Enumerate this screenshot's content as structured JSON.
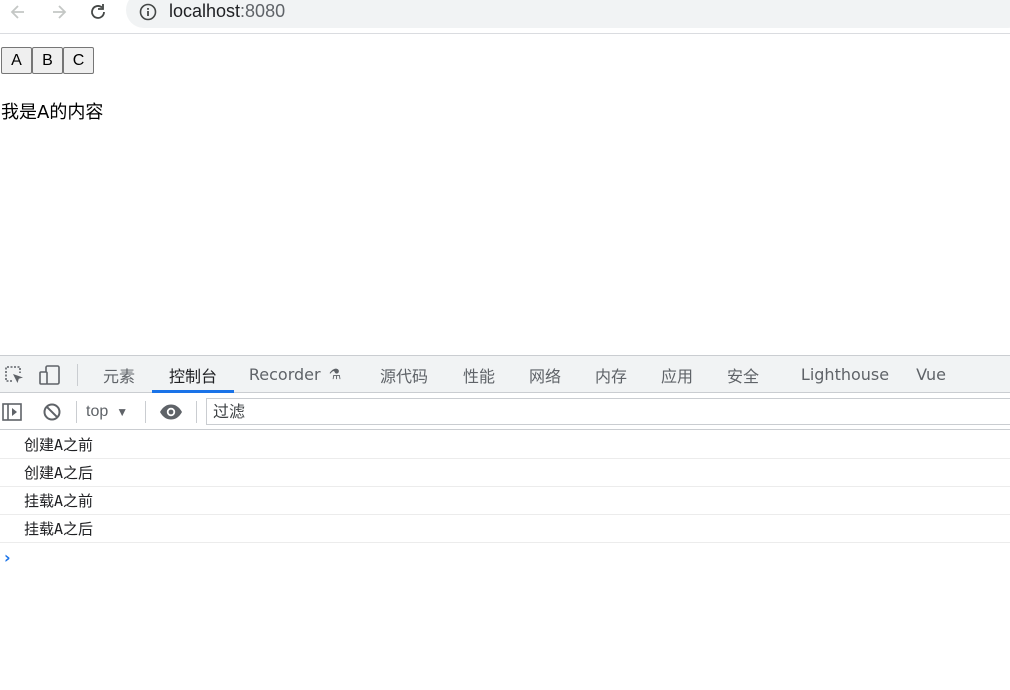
{
  "browser": {
    "url_host": "localhost",
    "url_port": ":8080",
    "icons": [
      "back-arrow-icon",
      "forward-arrow-icon",
      "reload-icon",
      "info-icon"
    ]
  },
  "page": {
    "buttons": [
      "A",
      "B",
      "C"
    ],
    "content_text": "我是A的内容"
  },
  "devtools": {
    "tabs": [
      "元素",
      "控制台",
      "Recorder",
      "源代码",
      "性能",
      "网络",
      "内存",
      "应用",
      "安全",
      "Lighthouse",
      "Vue"
    ],
    "active_tab": "控制台",
    "recorder_badge": "flask-icon",
    "toolbar": {
      "context": "top",
      "filter_placeholder": "过滤"
    },
    "console_logs": [
      "创建A之前",
      "创建A之后",
      "挂载A之前",
      "挂载A之后"
    ],
    "prompt_symbol": "›",
    "colors": {
      "accent": "#1a73e8",
      "tabbar_bg": "#f1f3f4"
    }
  }
}
